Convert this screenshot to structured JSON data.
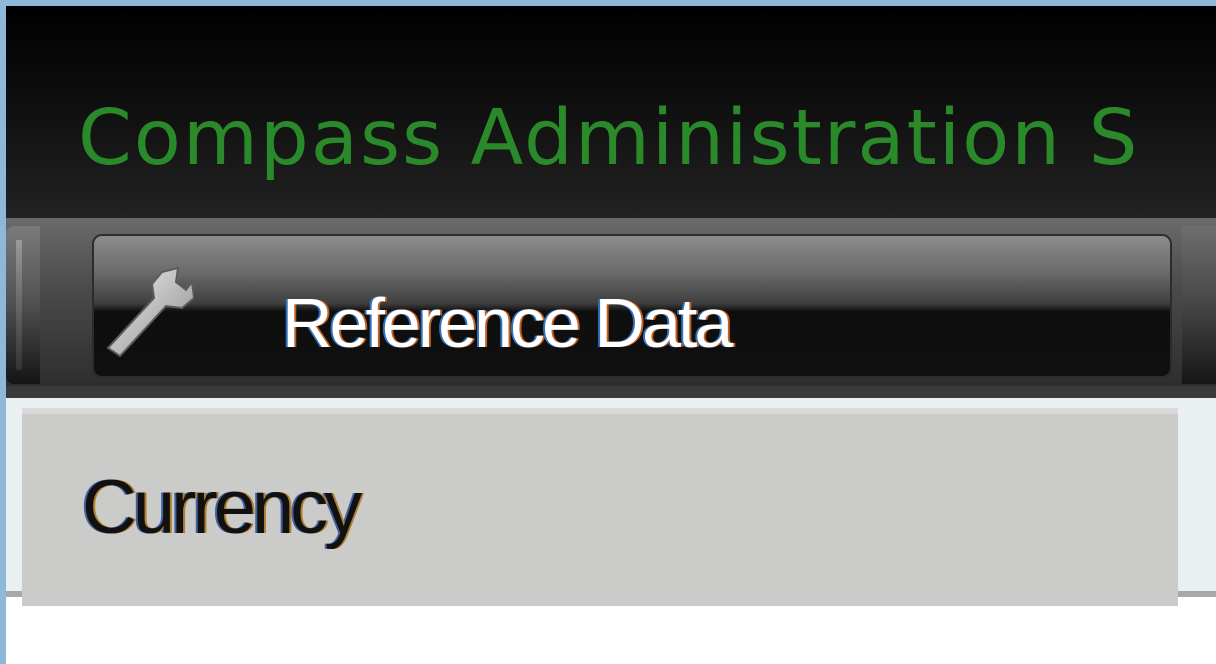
{
  "app": {
    "title": "Compass Administration S"
  },
  "toolbar": {
    "tab": {
      "label": "Reference Data",
      "icon": "wrench-icon"
    }
  },
  "menu": {
    "items": [
      {
        "label": "Currency"
      }
    ]
  },
  "colors": {
    "frame_border": "#8db8da",
    "title_green": "#2a8a2a",
    "panel_gray": "#cbcbc9",
    "band_light": "#e9f0f2"
  }
}
